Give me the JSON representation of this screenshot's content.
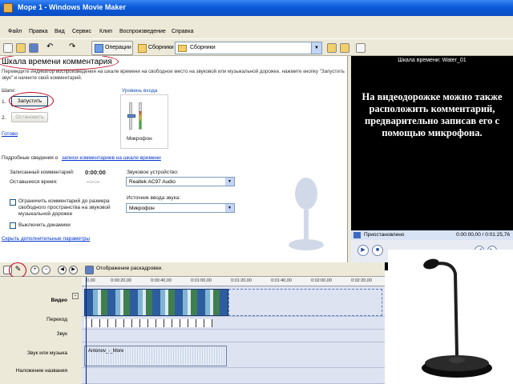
{
  "window": {
    "title": "Море 1 - Windows Movie Maker"
  },
  "menu": [
    "Файл",
    "Правка",
    "Вид",
    "Сервис",
    "Клип",
    "Воспроизведение",
    "Справка"
  ],
  "toolbar": {
    "operations_label": "Операции",
    "collections_label": "Сборники",
    "collections_select": "Сборники"
  },
  "task": {
    "title": "Шкала времени комментария",
    "hint": "Переведите индикатор воспроизведения на шкале времени на свободное место на звуковой или музыкальной дорожке, нажмите кнопку \"Запустить звук\" и начните свой комментарий.",
    "steps_label": "Шаги:",
    "step1": "1.",
    "step2": "2.",
    "start_button": "Запустить",
    "stop_button": "Остановить",
    "done_link": "Готово",
    "input_level_title": "Уровень входа",
    "mic_label": "Микрофон",
    "details_text": "Подробные сведения о",
    "details_link": "записи комментариев на шкале времени",
    "recorded_label": "Записанный комментарий:",
    "recorded_value": "0:00:00",
    "remaining_label": "Оставшееся время:",
    "remaining_value": "--:--:--",
    "device_label": "Звуковое устройство:",
    "device_value": "Realtek AC97 Audio",
    "source_label": "Источник ввода звука:",
    "source_value": "Микрофон",
    "limit_checkbox": "Ограничить комментарий до размера свободного пространства на звуковой музыкальной дорожке",
    "mute_checkbox": "Выключить динамики",
    "hide_link": "Скрыть дополнительные параметры"
  },
  "preview": {
    "title": "Шкала времени: Water_01",
    "overlay_text": "На видеодорожке можно также расположить комментарий, предварительно записав его с помощью микрофона.",
    "status": "Приостановлено",
    "time": "0:00:00,00 / 0:01:25,76"
  },
  "timeline": {
    "caption": "Отображение раскадровки.",
    "ruler": [
      "0,00",
      "0:00:20,00",
      "0:00:40,00",
      "0:01:00,00",
      "0:01:20,00",
      "0:01:40,00",
      "0:02:00,00",
      "0:02:20,00"
    ],
    "tracks": {
      "video": "Видео",
      "transition": "Переход",
      "audio": "Звук",
      "music": "Звук или музыка",
      "title_overlay": "Наложение названия"
    },
    "audio_clip": "Antonov_-_More"
  }
}
